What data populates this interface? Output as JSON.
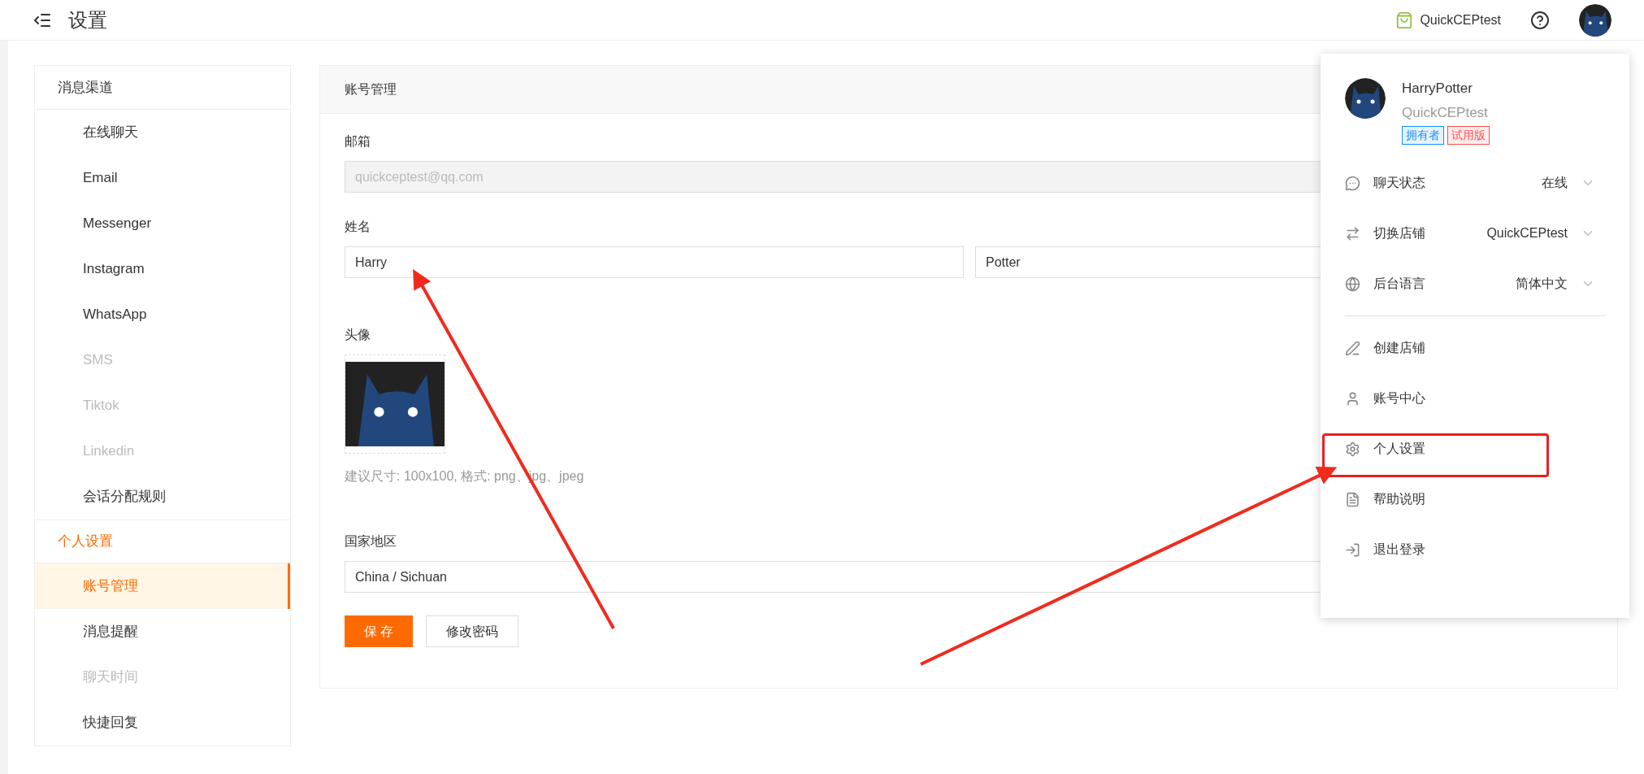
{
  "topbar": {
    "title": "设置",
    "store": "QuickCEPtest"
  },
  "sidebar": {
    "sections": [
      {
        "label": "消息渠道",
        "active": false,
        "items": [
          {
            "label": "在线聊天",
            "selected": false,
            "disabled": false
          },
          {
            "label": "Email",
            "selected": false,
            "disabled": false
          },
          {
            "label": "Messenger",
            "selected": false,
            "disabled": false
          },
          {
            "label": "Instagram",
            "selected": false,
            "disabled": false
          },
          {
            "label": "WhatsApp",
            "selected": false,
            "disabled": false
          },
          {
            "label": "SMS",
            "selected": false,
            "disabled": true
          },
          {
            "label": "Tiktok",
            "selected": false,
            "disabled": true
          },
          {
            "label": "Linkedin",
            "selected": false,
            "disabled": true
          },
          {
            "label": "会话分配规则",
            "selected": false,
            "disabled": false
          }
        ]
      },
      {
        "label": "个人设置",
        "active": true,
        "items": [
          {
            "label": "账号管理",
            "selected": true,
            "disabled": false
          },
          {
            "label": "消息提醒",
            "selected": false,
            "disabled": false
          },
          {
            "label": "聊天时间",
            "selected": false,
            "disabled": true
          },
          {
            "label": "快捷回复",
            "selected": false,
            "disabled": false
          }
        ]
      }
    ]
  },
  "panel": {
    "title": "账号管理",
    "email": {
      "label": "邮箱",
      "value": "quickceptest@qq.com",
      "disabled": true
    },
    "name": {
      "label": "姓名",
      "first": "Harry",
      "last": "Potter"
    },
    "avatar": {
      "label": "头像",
      "hint": "建议尺寸: 100x100, 格式: png、jpg、jpeg"
    },
    "region": {
      "label": "国家地区",
      "value": "China / Sichuan"
    },
    "buttons": [
      {
        "label": "保 存",
        "kind": "primary"
      },
      {
        "label": "修改密码",
        "kind": "default"
      }
    ]
  },
  "account_menu": {
    "user": "HarryPotter",
    "store": "QuickCEPtest",
    "badges": [
      {
        "label": "拥有者",
        "color": "#1890ff"
      },
      {
        "label": "试用版",
        "color": "#ff4d4f"
      }
    ],
    "settings": [
      {
        "label": "聊天状态",
        "value": "在线",
        "kind": "chat"
      },
      {
        "label": "切换店铺",
        "value": "QuickCEPtest",
        "kind": "swap"
      },
      {
        "label": "后台语言",
        "value": "简体中文",
        "kind": "globe"
      }
    ],
    "actions": [
      {
        "label": "创建店铺",
        "kind": "pen"
      },
      {
        "label": "账号中心",
        "kind": "user"
      },
      {
        "label": "个人设置",
        "kind": "gear"
      },
      {
        "label": "帮助说明",
        "kind": "doc"
      },
      {
        "label": "退出登录",
        "kind": "logout"
      }
    ]
  }
}
